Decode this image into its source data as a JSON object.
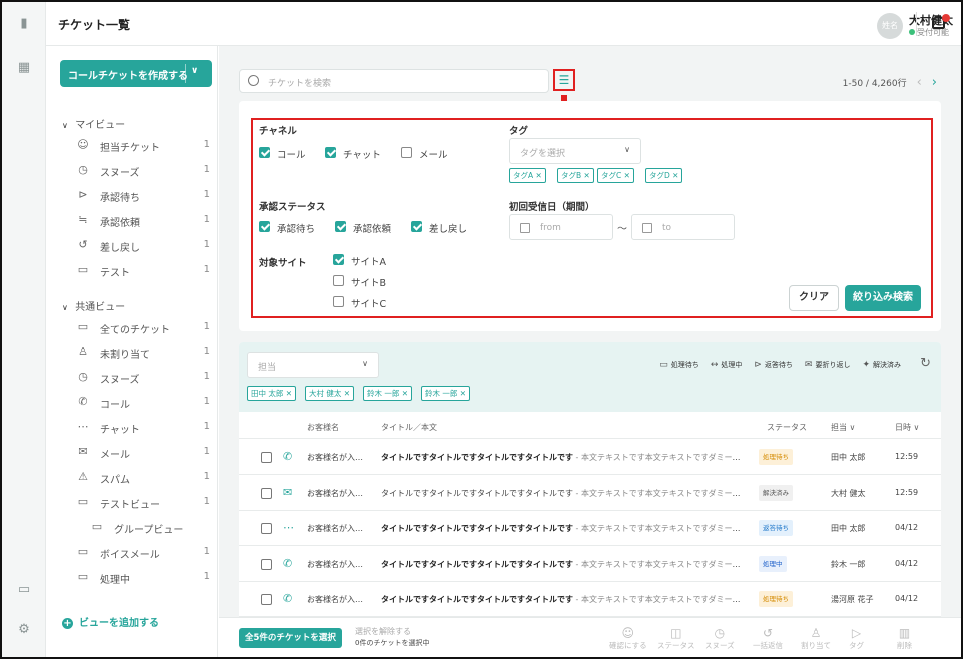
{
  "header": {
    "title": "チケット一覧",
    "avatar_text": "姓名",
    "user_name": "大村健太",
    "user_status": "受付可能"
  },
  "sidebar": {
    "create_label": "コールチケットを作成する",
    "my_view_label": "マイビュー",
    "my_view": [
      {
        "label": "担当チケット",
        "count": "1",
        "icon": "assigned-icon",
        "glyph": "☺"
      },
      {
        "label": "スヌーズ",
        "count": "1",
        "icon": "clock-icon",
        "glyph": "◷"
      },
      {
        "label": "承認待ち",
        "count": "1",
        "icon": "pending-approval-icon",
        "glyph": "⊳"
      },
      {
        "label": "承認依頼",
        "count": "1",
        "icon": "approval-request-icon",
        "glyph": "≒"
      },
      {
        "label": "差し戻し",
        "count": "1",
        "icon": "sendback-icon",
        "glyph": "↺"
      },
      {
        "label": "テスト",
        "count": "1",
        "icon": "inbox-icon",
        "glyph": "▭"
      }
    ],
    "shared_view_label": "共通ビュー",
    "shared_view": [
      {
        "label": "全てのチケット",
        "count": "1",
        "icon": "inbox-icon",
        "glyph": "▭"
      },
      {
        "label": "未割り当て",
        "count": "1",
        "icon": "unassigned-icon",
        "glyph": "♙"
      },
      {
        "label": "スヌーズ",
        "count": "1",
        "icon": "clock-icon",
        "glyph": "◷"
      },
      {
        "label": "コール",
        "count": "1",
        "icon": "phone-icon",
        "glyph": "✆"
      },
      {
        "label": "チャット",
        "count": "1",
        "icon": "chat-icon",
        "glyph": "⋯"
      },
      {
        "label": "メール",
        "count": "1",
        "icon": "mail-icon",
        "glyph": "✉"
      },
      {
        "label": "スパム",
        "count": "1",
        "icon": "warning-icon",
        "glyph": "⚠"
      },
      {
        "label": "テストビュー",
        "count": "1",
        "icon": "inbox-icon",
        "glyph": "▭"
      },
      {
        "label": "グループビュー",
        "count": "",
        "icon": "inbox-icon",
        "glyph": "▭"
      },
      {
        "label": "ボイスメール",
        "count": "1",
        "icon": "inbox-icon",
        "glyph": "▭"
      },
      {
        "label": "処理中",
        "count": "1",
        "icon": "inbox-icon",
        "glyph": "▭"
      }
    ],
    "add_view_label": "ビューを追加する"
  },
  "search": {
    "placeholder": "チケットを検索",
    "pager": "1-50 / 4,260行"
  },
  "filter": {
    "channel_label": "チャネル",
    "channels": [
      {
        "label": "コール",
        "checked": true
      },
      {
        "label": "チャット",
        "checked": true
      },
      {
        "label": "メール",
        "checked": false
      }
    ],
    "tag_label": "タグ",
    "tag_placeholder": "タグを選択",
    "tags": [
      "タグA ✕",
      "タグB ✕",
      "タグC ✕",
      "タグD ✕"
    ],
    "approval_label": "承認ステータス",
    "approvals": [
      {
        "label": "承認待ち",
        "checked": true
      },
      {
        "label": "承認依頼",
        "checked": true
      },
      {
        "label": "差し戻し",
        "checked": true
      }
    ],
    "date_label": "初回受信日（期間）",
    "date_from": "from",
    "date_to": "to",
    "date_sep": "〜",
    "site_label": "対象サイト",
    "sites": [
      {
        "label": "サイトA",
        "checked": true
      },
      {
        "label": "サイトB",
        "checked": false
      },
      {
        "label": "サイトC",
        "checked": false
      }
    ],
    "clear_label": "クリア",
    "apply_label": "絞り込み検索"
  },
  "list": {
    "assignee_placeholder": "担当",
    "actions": [
      {
        "label": "処理待ち",
        "glyph": "▭"
      },
      {
        "label": "処理中",
        "glyph": "↔"
      },
      {
        "label": "返答待ち",
        "glyph": "⊳"
      },
      {
        "label": "要折り返し",
        "glyph": "✉"
      },
      {
        "label": "解決済み",
        "glyph": "✦"
      }
    ],
    "assignee_chips": [
      "田中 太郎 ✕",
      "大村 健太 ✕",
      "鈴木 一郎 ✕",
      "鈴木 一郎 ✕"
    ],
    "columns": {
      "customer": "お客様名",
      "title": "タイトル／本文",
      "status": "ステータス",
      "assignee": "担当 ∨",
      "date": "日時 ∨"
    },
    "rows": [
      {
        "channel": "✆",
        "channel_icon": "phone-icon",
        "customer": "お客様名が入…",
        "title": "タイトルですタイトルですタイトルですタイトルです",
        "body": "- 本文テキストです本文テキストですダミーテ…",
        "title_bold": true,
        "status": "処理待ち",
        "status_bg": "#fdf0d8",
        "status_fg": "#d48a00",
        "assignee": "田中 太郎",
        "date": "12:59"
      },
      {
        "channel": "✉",
        "channel_icon": "mail-icon",
        "customer": "お客様名が入…",
        "title": "タイトルですタイトルですタイトルですタイトルです",
        "body": "- 本文テキストです本文テキストですダミーテ…",
        "title_bold": false,
        "status": "解決済み",
        "status_bg": "#f0f0f0",
        "status_fg": "#555555",
        "assignee": "大村 健太",
        "date": "12:59"
      },
      {
        "channel": "⋯",
        "channel_icon": "chat-icon",
        "customer": "お客様名が入…",
        "title": "タイトルですタイトルですタイトルですタイトルです",
        "body": "- 本文テキストです本文テキストですダミーテ…",
        "title_bold": true,
        "status": "返答待ち",
        "status_bg": "#e3f0fc",
        "status_fg": "#1d76c9",
        "assignee": "田中 太郎",
        "date": "04/12"
      },
      {
        "channel": "✆",
        "channel_icon": "phone-icon",
        "customer": "お客様名が入…",
        "title": "タイトルですタイトルですタイトルですタイトルです",
        "body": "- 本文テキストです本文テキストですダミーテ…",
        "title_bold": true,
        "status": "処理中",
        "status_bg": "#e8f0fc",
        "status_fg": "#1d5fc9",
        "assignee": "鈴木 一郎",
        "date": "04/12"
      },
      {
        "channel": "✆",
        "channel_icon": "phone-icon",
        "customer": "お客様名が入…",
        "title": "タイトルですタイトルですタイトルですタイトルです",
        "body": "- 本文テキストです本文テキストですダミーテ…",
        "title_bold": true,
        "status": "処理待ち",
        "status_bg": "#fdf0d8",
        "status_fg": "#d48a00",
        "assignee": "湯河原 花子",
        "date": "04/12"
      }
    ]
  },
  "bottom": {
    "select_all": "全5件のチケットを選択",
    "clear_selection": "選択を解除する",
    "selected_count": "0件のチケットを選択中",
    "actions": [
      {
        "label": "確認にする",
        "glyph": "☺"
      },
      {
        "label": "ステータス",
        "glyph": "◫"
      },
      {
        "label": "スヌーズ",
        "glyph": "◷"
      },
      {
        "label": "一括返信",
        "glyph": "↺"
      },
      {
        "label": "割り当て",
        "glyph": "♙"
      },
      {
        "label": "タグ",
        "glyph": "▷"
      },
      {
        "label": "削除",
        "glyph": "▥"
      }
    ]
  },
  "colors": {
    "accent": "#27a59b",
    "highlight": "#e02020"
  }
}
